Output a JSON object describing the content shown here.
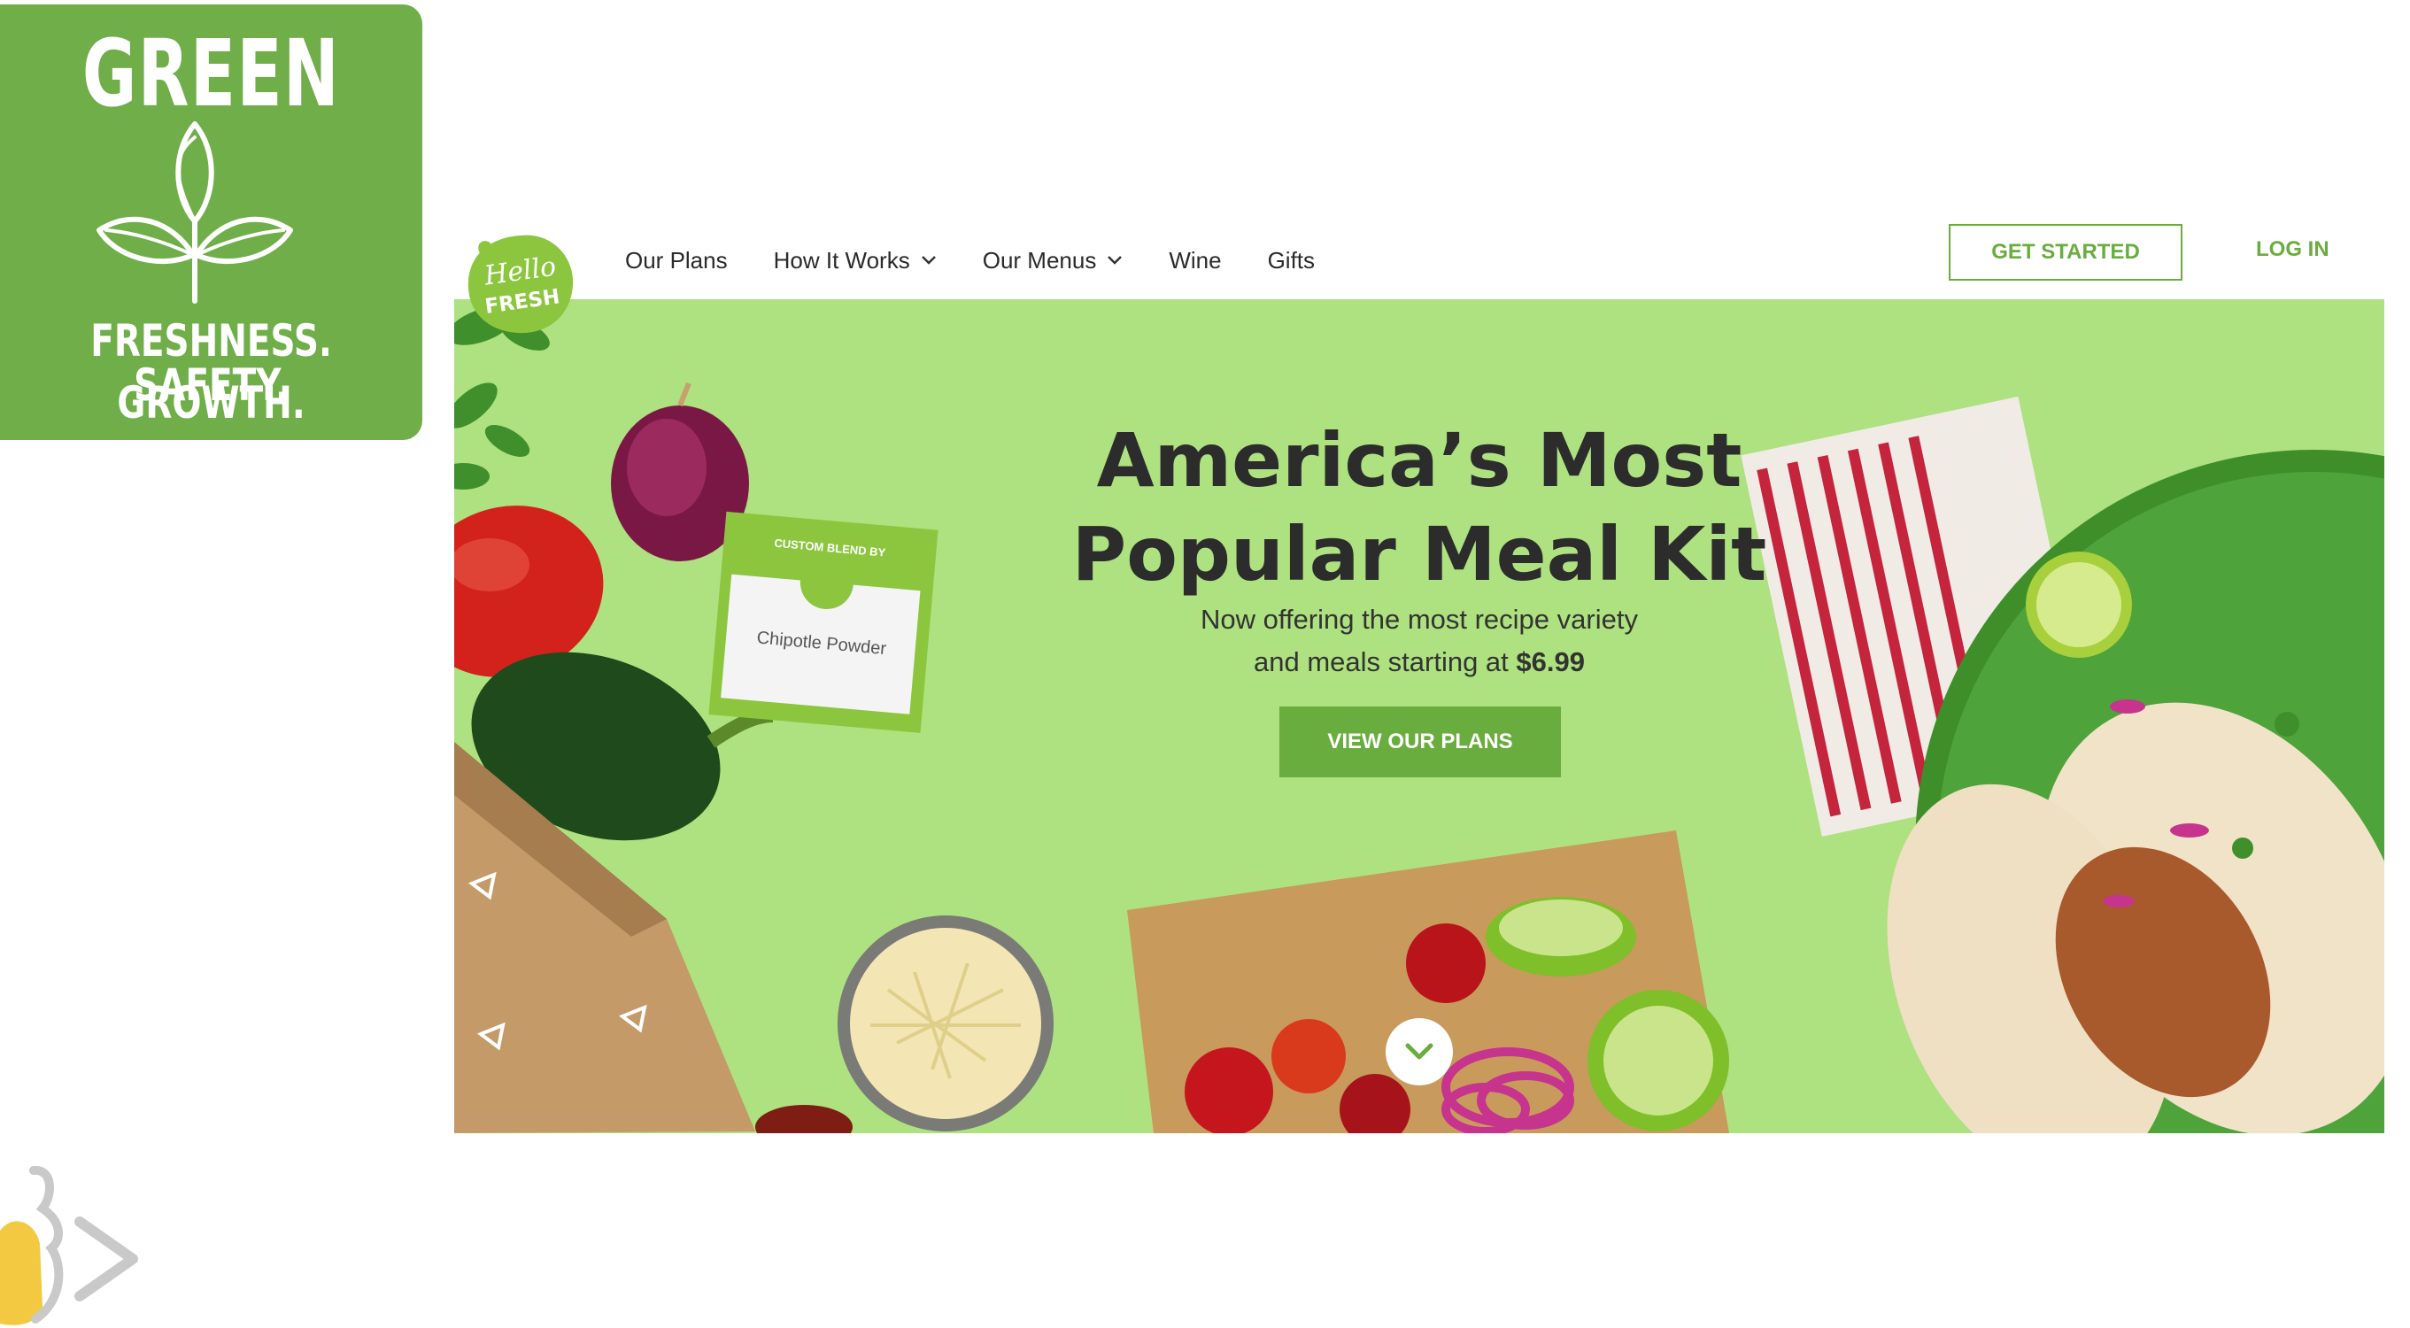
{
  "badge": {
    "title": "GREEN",
    "line1": "FRESHNESS. SAFETY.",
    "line2": "GROWTH.",
    "icon": "leaf-sprout-icon",
    "color": "#6fae48"
  },
  "site": {
    "logo": {
      "line1": "Hello",
      "line2": "FRESH",
      "color": "#8cc63f"
    },
    "nav": [
      {
        "label": "Our Plans",
        "dropdown": false
      },
      {
        "label": "How It Works",
        "dropdown": true
      },
      {
        "label": "Our Menus",
        "dropdown": true
      },
      {
        "label": "Wine",
        "dropdown": false
      },
      {
        "label": "Gifts",
        "dropdown": false
      }
    ],
    "get_started": "GET STARTED",
    "login": "LOG IN",
    "accent": "#6aad3f"
  },
  "hero": {
    "title_line1": "America’s Most",
    "title_line2": "Popular Meal Kit",
    "subtitle_line1": "Now offering the most recipe variety",
    "subtitle_line2_prefix": "and meals starting at ",
    "price": "$6.99",
    "cta": "VIEW OUR PLANS",
    "spice_packet": {
      "line1": "Chipotle Powder",
      "header": "CUSTOM BLEND BY"
    },
    "background": "#aee17f",
    "scroll_icon": "chevron-down-icon"
  }
}
